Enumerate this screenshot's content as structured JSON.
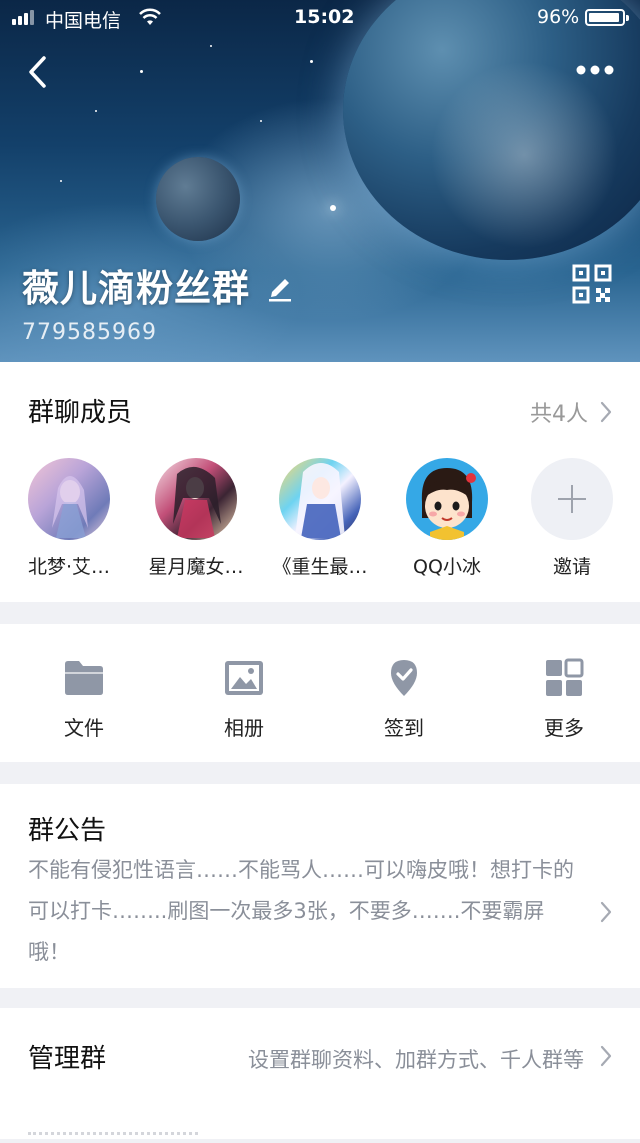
{
  "status_bar": {
    "carrier": "中国电信",
    "time": "15:02",
    "battery": "96%"
  },
  "header": {
    "group_name": "薇儿滴粉丝群",
    "group_id": "779585969"
  },
  "members": {
    "title": "群聊成员",
    "count": "共4人",
    "list": [
      {
        "name": "北梦·艾…"
      },
      {
        "name": "星月魔女…"
      },
      {
        "name": "《重生最…"
      },
      {
        "name": "QQ小冰"
      }
    ],
    "invite_label": "邀请"
  },
  "tools": [
    {
      "label": "文件",
      "icon": "folder-icon"
    },
    {
      "label": "相册",
      "icon": "image-icon"
    },
    {
      "label": "签到",
      "icon": "checkin-icon"
    },
    {
      "label": "更多",
      "icon": "grid-icon"
    }
  ],
  "notice": {
    "title": "群公告",
    "text": "不能有侵犯性语言……不能骂人……可以嗨皮哦！想打卡的可以打卡……..刷图一次最多3张，不要多…….不要霸屏哦！"
  },
  "manage": {
    "title": "管理群",
    "desc": "设置群聊资料、加群方式、千人群等"
  },
  "colors": {
    "icon_gray": "#8f97a6",
    "text_secondary": "#8a8f99",
    "background": "#f0f1f5"
  }
}
